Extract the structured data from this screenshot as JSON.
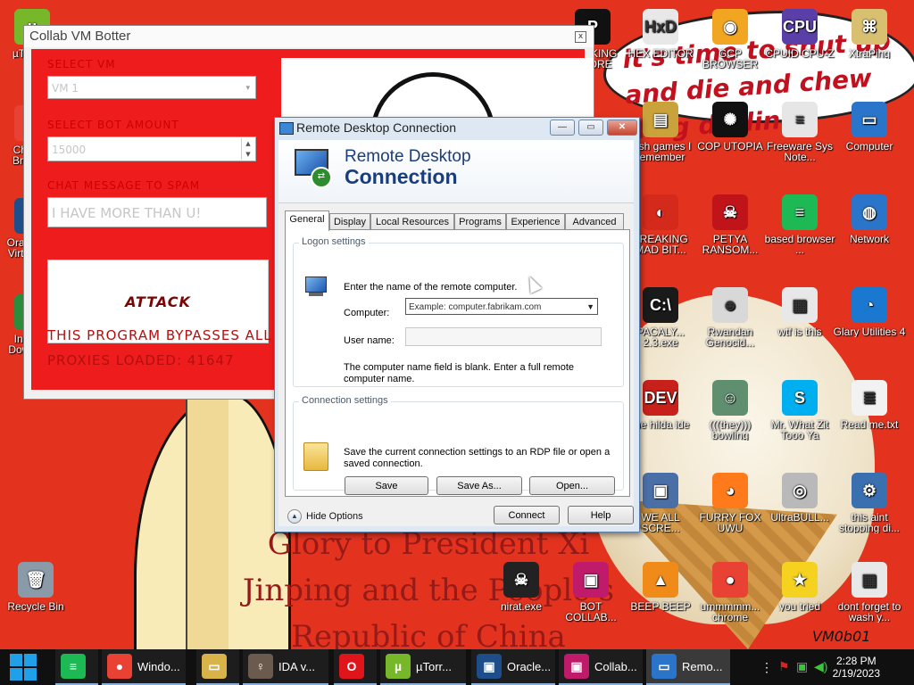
{
  "wallpaper": {
    "cloud_text": "it's time to shut up\nand die and chew\nding drilling",
    "big_text": "Glory to President Xi\nJinping and the People's\nRepublic of China",
    "signature": "VM0b01"
  },
  "desktop_icons": [
    {
      "label": "µTorrent",
      "color": "#77b82a",
      "glyph": "µ"
    },
    {
      "label": "Chrome Browser",
      "color": "#e94235",
      "glyph": "●"
    },
    {
      "label": "Oracle VM VirtualBox",
      "color": "#1d4e89",
      "glyph": "▣"
    },
    {
      "label": "Internet Download",
      "color": "#2b8d3c",
      "glyph": "⇓"
    },
    {
      "label": "Recycle Bin",
      "color": "#8a9aa8",
      "glyph": "🗑"
    },
    {
      "label": "HACKING CHORE",
      "color": "#111111",
      "glyph": "P"
    },
    {
      "label": "HEX EDITOR",
      "color": "#e8e8e8",
      "glyph": "HxD"
    },
    {
      "label": "GCP BROWSER",
      "color": "#f2a520",
      "glyph": "◉"
    },
    {
      "label": "CPUID CPU-Z",
      "color": "#5a3fa8",
      "glyph": "CPU"
    },
    {
      "label": "XtraPing",
      "color": "#d8c070",
      "glyph": "⌘"
    },
    {
      "label": "Fish games I remember",
      "color": "#caa23c",
      "glyph": "▤"
    },
    {
      "label": "COP UTOPIA",
      "color": "#111111",
      "glyph": "✺"
    },
    {
      "label": "Freeware Sys Note...",
      "color": "#e6e6e6",
      "glyph": "≡"
    },
    {
      "label": "Computer",
      "color": "#2a74c9",
      "glyph": "▭"
    },
    {
      "label": "FREAKING MAD BIT...",
      "color": "#d42a1c",
      "glyph": "◐"
    },
    {
      "label": "PETYA RANSOM...",
      "color": "#c0141a",
      "glyph": "☠"
    },
    {
      "label": "based browser ...",
      "color": "#1db954",
      "glyph": "≡"
    },
    {
      "label": "Network",
      "color": "#2a74c9",
      "glyph": "◍"
    },
    {
      "label": "PACALY... 2.3.exe",
      "color": "#1a1a1a",
      "glyph": "C:\\"
    },
    {
      "label": "Rwandan Genocid...",
      "color": "#d8d8d8",
      "glyph": "☻"
    },
    {
      "label": "wtf is this",
      "color": "#e8e8e8",
      "glyph": "▦"
    },
    {
      "label": "Glary Utilities 4",
      "color": "#1b78d0",
      "glyph": "◔"
    },
    {
      "label": "the hilda ide",
      "color": "#c8201a",
      "glyph": "DEV"
    },
    {
      "label": "(((they))) bowling",
      "color": "#5f8f6f",
      "glyph": "☺"
    },
    {
      "label": "Mr. What Zit Tooo Ya",
      "color": "#00aff0",
      "glyph": "S"
    },
    {
      "label": "Read me.txt",
      "color": "#f2f2f2",
      "glyph": "≣"
    },
    {
      "label": "WE ALL SCRE...",
      "color": "#4a6fa6",
      "glyph": "▣"
    },
    {
      "label": "FURRY FOX UWU",
      "color": "#ff7a1a",
      "glyph": "◕"
    },
    {
      "label": "UltraBULL...",
      "color": "#b9b9b9",
      "glyph": "◎"
    },
    {
      "label": "this aint stopping di...",
      "color": "#3a6fb0",
      "glyph": "⚙"
    },
    {
      "label": "nirat.exe",
      "color": "#222222",
      "glyph": "☠"
    },
    {
      "label": "BOT COLLAB...",
      "color": "#c01a6a",
      "glyph": "▣"
    },
    {
      "label": "BEEP BEEP",
      "color": "#f08a18",
      "glyph": "▲"
    },
    {
      "label": "ummmmm... chrome",
      "color": "#e94235",
      "glyph": "●"
    },
    {
      "label": "you tried",
      "color": "#f5d21f",
      "glyph": "★"
    },
    {
      "label": "dont forget to wash y...",
      "color": "#e8e8e8",
      "glyph": "▦"
    }
  ],
  "botter": {
    "title": "Collab VM Botter",
    "close": "x",
    "select_vm_label": "SELECT VM",
    "select_vm_value": "VM 1",
    "bot_amount_label": "SELECT BOT AMOUNT",
    "bot_amount_value": "15000",
    "chat_label": "CHAT MESSAGE TO SPAM",
    "chat_value": "I HAVE MORE THAN U!",
    "attack_label": "ATTACK",
    "bypass_text": "THIS PROGRAM BYPASSES ALL",
    "proxies_text": "PROXIES LOADED: 41647"
  },
  "rdp": {
    "title": "Remote Desktop Connection",
    "banner_line1": "Remote Desktop",
    "banner_line2": "Connection",
    "tabs": [
      "General",
      "Display",
      "Local Resources",
      "Programs",
      "Experience",
      "Advanced"
    ],
    "logon_group": "Logon settings",
    "logon_intro": "Enter the name of the remote computer.",
    "computer_label": "Computer:",
    "computer_placeholder": "Example: computer.fabrikam.com",
    "username_label": "User name:",
    "blank_msg": "The computer name field is blank. Enter a full remote computer name.",
    "conn_group": "Connection settings",
    "conn_desc": "Save the current connection settings to an RDP file or open a saved connection.",
    "save": "Save",
    "save_as": "Save As...",
    "open": "Open...",
    "hide_options": "Hide Options",
    "connect": "Connect",
    "help": "Help",
    "min": "—",
    "max": "▭",
    "close": "✕"
  },
  "taskbar": {
    "apps": [
      {
        "label": "",
        "color": "#1db954",
        "glyph": "≡"
      },
      {
        "label": "Windo...",
        "color": "#e94235",
        "glyph": "●"
      },
      {
        "label": "",
        "color": "#d8b34a",
        "glyph": "▭"
      },
      {
        "label": "IDA v...",
        "color": "#6b5a4e",
        "glyph": "♀"
      },
      {
        "label": "",
        "color": "#e0151b",
        "glyph": "O"
      },
      {
        "label": "µTorr...",
        "color": "#77b82a",
        "glyph": "µ"
      },
      {
        "label": "Oracle...",
        "color": "#1d4e89",
        "glyph": "▣"
      },
      {
        "label": "Collab...",
        "color": "#c01a6a",
        "glyph": "▣"
      },
      {
        "label": "Remo...",
        "color": "#2a74c9",
        "glyph": "▭"
      }
    ],
    "time": "2:28 PM",
    "date": "2/19/2023"
  }
}
